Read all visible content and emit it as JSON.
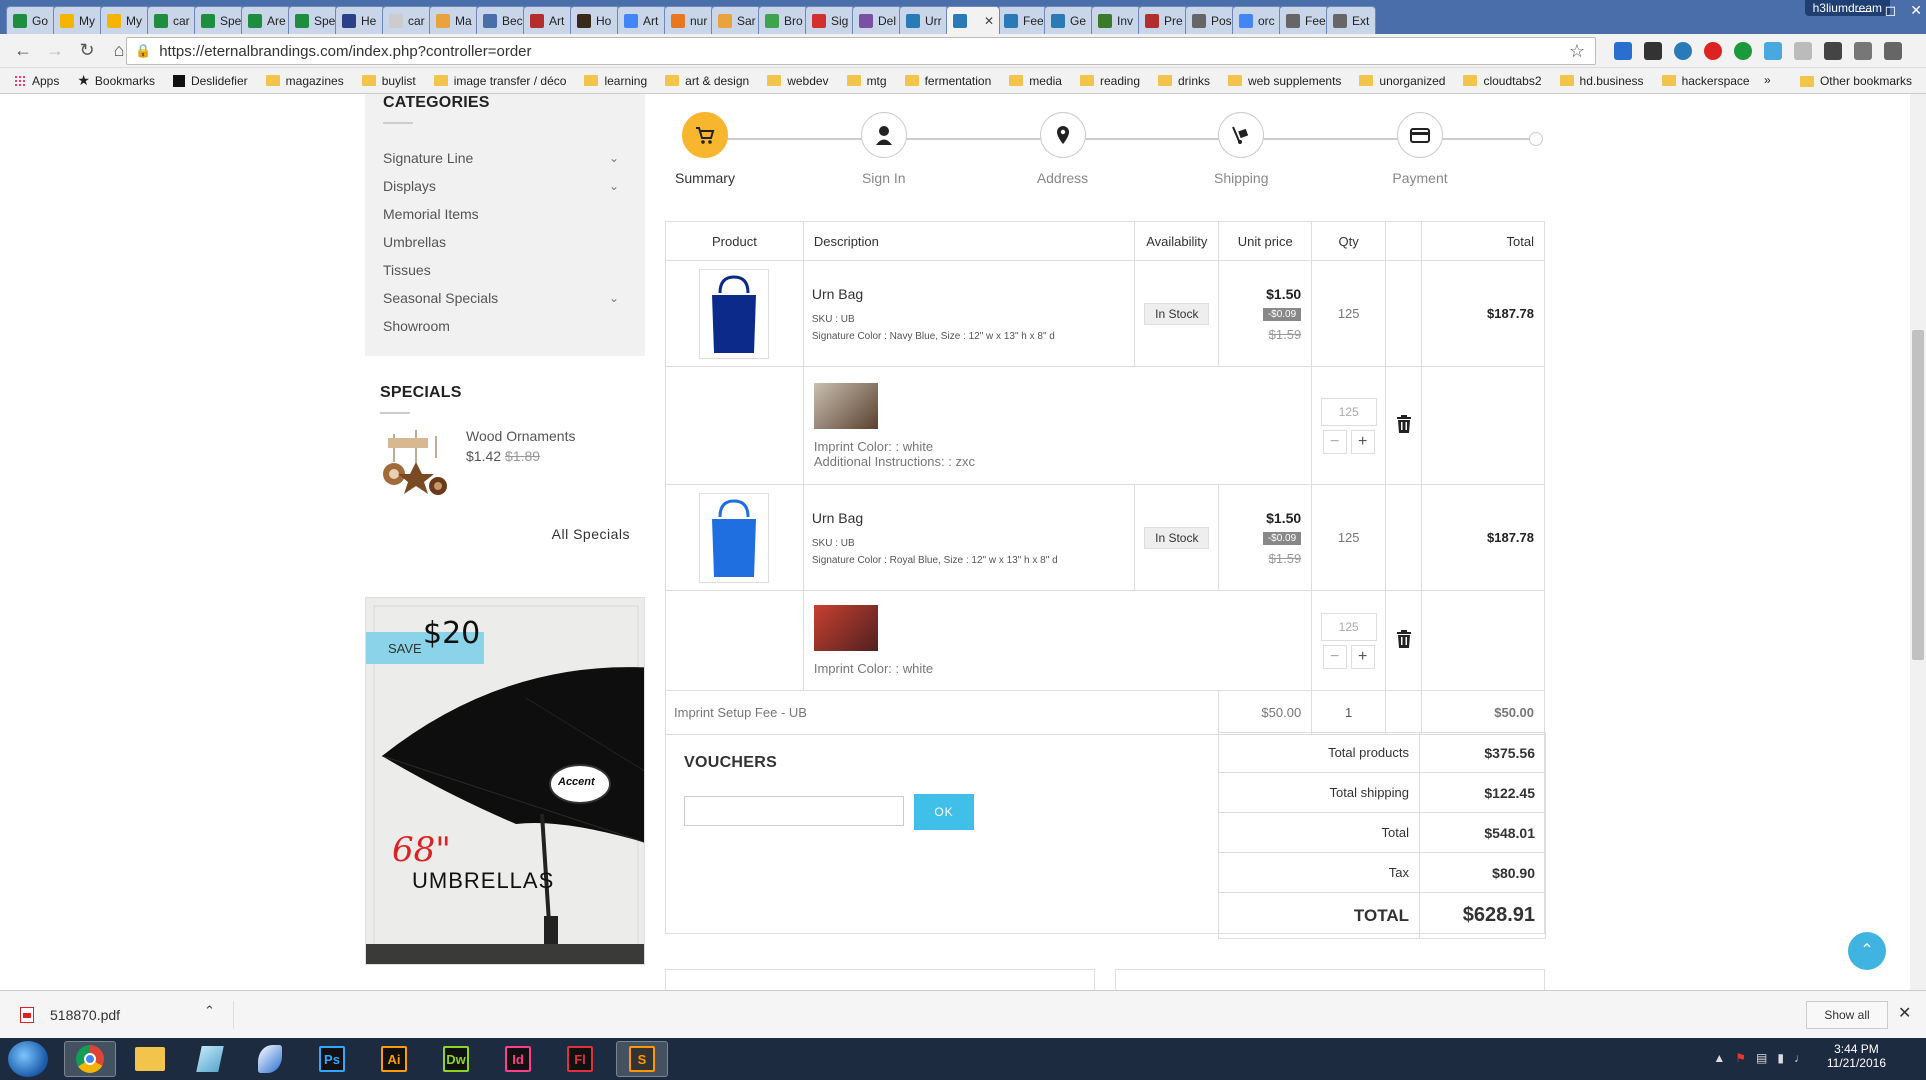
{
  "browser": {
    "tabs": [
      {
        "label": "Go",
        "color": "#1e8e3e"
      },
      {
        "label": "My",
        "color": "#f4b400"
      },
      {
        "label": "My",
        "color": "#f4b400"
      },
      {
        "label": "car",
        "color": "#1e8e3e"
      },
      {
        "label": "Spe",
        "color": "#1e8e3e"
      },
      {
        "label": "Are",
        "color": "#1e8e3e"
      },
      {
        "label": "Spe",
        "color": "#1e8e3e"
      },
      {
        "label": "He",
        "color": "#2a3f88"
      },
      {
        "label": "car",
        "color": "#cccccc"
      },
      {
        "label": "Ma",
        "color": "#e8a33c"
      },
      {
        "label": "Bec",
        "color": "#4a6ea9"
      },
      {
        "label": "Art",
        "color": "#b52e2e"
      },
      {
        "label": "Ho",
        "color": "#3a2a1a"
      },
      {
        "label": "Art",
        "color": "#4285f4"
      },
      {
        "label": "nur",
        "color": "#e87722"
      },
      {
        "label": "Sar",
        "color": "#e8a33c"
      },
      {
        "label": "Bro",
        "color": "#3fa34d"
      },
      {
        "label": "Sig",
        "color": "#d32f2f"
      },
      {
        "label": "Del",
        "color": "#7b4fa3"
      },
      {
        "label": "Urr",
        "color": "#2a7ab8"
      },
      {
        "label": "",
        "color": "#2a7ab8",
        "active": true
      },
      {
        "label": "Fee",
        "color": "#2a7ab8"
      },
      {
        "label": "Ge",
        "color": "#2a7ab8"
      },
      {
        "label": "Inv",
        "color": "#3a7a2a"
      },
      {
        "label": "Pre",
        "color": "#b52e2e"
      },
      {
        "label": "Pos",
        "color": "#666666"
      },
      {
        "label": "orc",
        "color": "#4285f4"
      },
      {
        "label": "Fee",
        "color": "#666666"
      },
      {
        "label": "Ext",
        "color": "#666666"
      }
    ],
    "profile": "h3liumdream",
    "url": "https://eternalbrandings.com/index.php?controller=order",
    "bookmarks": [
      {
        "label": "Apps",
        "type": "apps"
      },
      {
        "label": "Bookmarks",
        "type": "star"
      },
      {
        "label": "Deslidefier",
        "type": "page"
      },
      {
        "label": "magazines",
        "type": "folder"
      },
      {
        "label": "buylist",
        "type": "folder"
      },
      {
        "label": "image transfer / déco",
        "type": "folder"
      },
      {
        "label": "learning",
        "type": "folder"
      },
      {
        "label": "art & design",
        "type": "folder"
      },
      {
        "label": "webdev",
        "type": "folder"
      },
      {
        "label": "mtg",
        "type": "folder"
      },
      {
        "label": "fermentation",
        "type": "folder"
      },
      {
        "label": "media",
        "type": "folder"
      },
      {
        "label": "reading",
        "type": "folder"
      },
      {
        "label": "drinks",
        "type": "folder"
      },
      {
        "label": "web supplements",
        "type": "folder"
      },
      {
        "label": "unorganized",
        "type": "folder"
      },
      {
        "label": "cloudtabs2",
        "type": "folder"
      },
      {
        "label": "hd.business",
        "type": "folder"
      },
      {
        "label": "hackerspace",
        "type": "folder"
      }
    ],
    "bookmarks_more": "»",
    "other_bookmarks": "Other bookmarks"
  },
  "sidebar": {
    "categories_title": "CATEGORIES",
    "categories": [
      {
        "label": "Signature Line",
        "expandable": true
      },
      {
        "label": "Displays",
        "expandable": true
      },
      {
        "label": "Memorial Items",
        "expandable": false
      },
      {
        "label": "Umbrellas",
        "expandable": false
      },
      {
        "label": "Tissues",
        "expandable": false
      },
      {
        "label": "Seasonal Specials",
        "expandable": true
      },
      {
        "label": "Showroom",
        "expandable": false
      }
    ],
    "specials_title": "SPECIALS",
    "special_item": {
      "name": "Wood Ornaments",
      "price": "$1.42",
      "old_price": "$1.89"
    },
    "all_specials": "All Specials",
    "banner": {
      "save_label": "SAVE",
      "save_amount": "$20",
      "size": "68\"",
      "title": "UMBRELLAS",
      "logo_text": "Accent"
    }
  },
  "steps": [
    {
      "label": "Summary",
      "icon": "cart-icon",
      "active": true
    },
    {
      "label": "Sign In",
      "icon": "user-icon",
      "active": false
    },
    {
      "label": "Address",
      "icon": "map-pin-icon",
      "active": false
    },
    {
      "label": "Shipping",
      "icon": "hand-truck-icon",
      "active": false
    },
    {
      "label": "Payment",
      "icon": "credit-card-icon",
      "active": false
    }
  ],
  "cart": {
    "headers": {
      "product": "Product",
      "description": "Description",
      "availability": "Availability",
      "unit_price": "Unit price",
      "qty": "Qty",
      "total": "Total"
    },
    "items": [
      {
        "name": "Urn Bag",
        "sku": "SKU : UB",
        "attributes": "Signature Color : Navy Blue, Size : 12\" w x 13\" h x 8\" d",
        "availability": "In Stock",
        "price": "$1.50",
        "discount": "-$0.09",
        "old_price": "$1.59",
        "qty": "125",
        "total": "$187.78",
        "bag_color": "#0b2a8a",
        "customization": {
          "lines": [
            "Imprint Color: : white",
            "Additional Instructions: : zxc"
          ],
          "qty": "125"
        }
      },
      {
        "name": "Urn Bag",
        "sku": "SKU : UB",
        "attributes": "Signature Color : Royal Blue, Size : 12\" w x 13\" h x 8\" d",
        "availability": "In Stock",
        "price": "$1.50",
        "discount": "-$0.09",
        "old_price": "$1.59",
        "qty": "125",
        "total": "$187.78",
        "bag_color": "#1f6fe0",
        "customization": {
          "lines": [
            "Imprint Color: : white"
          ],
          "qty": "125"
        }
      }
    ],
    "fee": {
      "label": "Imprint Setup Fee - UB",
      "price": "$50.00",
      "qty": "1",
      "total": "$50.00"
    }
  },
  "vouchers": {
    "title": "VOUCHERS",
    "input_value": "",
    "ok_label": "OK"
  },
  "totals": [
    {
      "label": "Total products",
      "value": "$375.56"
    },
    {
      "label": "Total shipping",
      "value": "$122.45"
    },
    {
      "label": "Total",
      "value": "$548.01"
    },
    {
      "label": "Tax",
      "value": "$80.90"
    },
    {
      "label": "TOTAL",
      "value": "$628.91",
      "grand": true
    }
  ],
  "downloads": {
    "file": "518870.pdf",
    "show_all": "Show all"
  },
  "taskbar": {
    "apps": [
      {
        "label": "",
        "kind": "chrome",
        "active": true
      },
      {
        "label": "",
        "kind": "explorer"
      },
      {
        "label": "",
        "kind": "glass"
      },
      {
        "label": "",
        "kind": "feather"
      },
      {
        "label": "Ps",
        "kind": "box",
        "color": "#31a8ff"
      },
      {
        "label": "Ai",
        "kind": "box",
        "color": "#ff9a00"
      },
      {
        "label": "Dw",
        "kind": "box",
        "color": "#8dd51f"
      },
      {
        "label": "Id",
        "kind": "box",
        "color": "#ff3d8b"
      },
      {
        "label": "Fl",
        "kind": "box",
        "color": "#e0303b"
      },
      {
        "label": "S",
        "kind": "sublime",
        "active": true
      }
    ],
    "time": "3:44 PM",
    "date": "11/21/2016"
  }
}
